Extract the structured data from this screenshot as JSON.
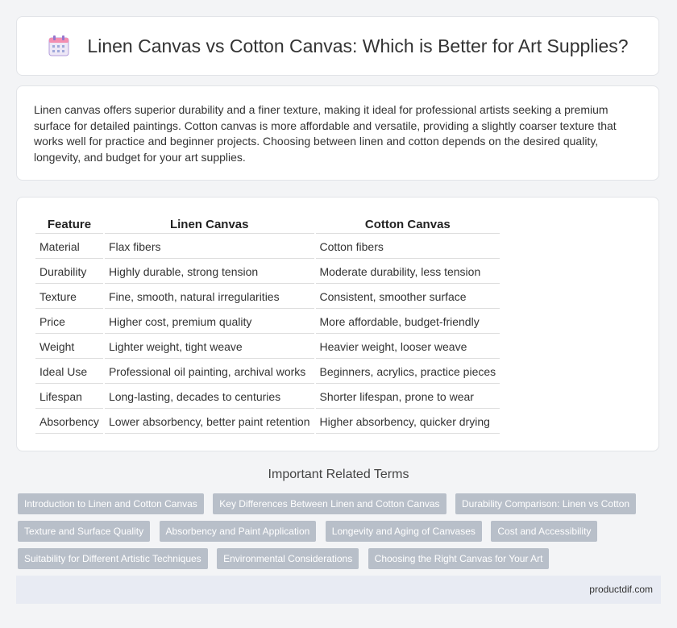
{
  "header": {
    "title": "Linen Canvas vs Cotton Canvas: Which is Better for Art Supplies?",
    "icon": "calendar-icon"
  },
  "intro": "Linen canvas offers superior durability and a finer texture, making it ideal for professional artists seeking a premium surface for detailed paintings. Cotton canvas is more affordable and versatile, providing a slightly coarser texture that works well for practice and beginner projects. Choosing between linen and cotton depends on the desired quality, longevity, and budget for your art supplies.",
  "table": {
    "headers": [
      "Feature",
      "Linen Canvas",
      "Cotton Canvas"
    ],
    "rows": [
      [
        "Material",
        "Flax fibers",
        "Cotton fibers"
      ],
      [
        "Durability",
        "Highly durable, strong tension",
        "Moderate durability, less tension"
      ],
      [
        "Texture",
        "Fine, smooth, natural irregularities",
        "Consistent, smoother surface"
      ],
      [
        "Price",
        "Higher cost, premium quality",
        "More affordable, budget-friendly"
      ],
      [
        "Weight",
        "Lighter weight, tight weave",
        "Heavier weight, looser weave"
      ],
      [
        "Ideal Use",
        "Professional oil painting, archival works",
        "Beginners, acrylics, practice pieces"
      ],
      [
        "Lifespan",
        "Long-lasting, decades to centuries",
        "Shorter lifespan, prone to wear"
      ],
      [
        "Absorbency",
        "Lower absorbency, better paint retention",
        "Higher absorbency, quicker drying"
      ]
    ]
  },
  "related": {
    "title": "Important Related Terms",
    "tags": [
      "Introduction to Linen and Cotton Canvas",
      "Key Differences Between Linen and Cotton Canvas",
      "Durability Comparison: Linen vs Cotton",
      "Texture and Surface Quality",
      "Absorbency and Paint Application",
      "Longevity and Aging of Canvases",
      "Cost and Accessibility",
      "Suitability for Different Artistic Techniques",
      "Environmental Considerations",
      "Choosing the Right Canvas for Your Art"
    ]
  },
  "footer": {
    "site": "productdif.com"
  }
}
